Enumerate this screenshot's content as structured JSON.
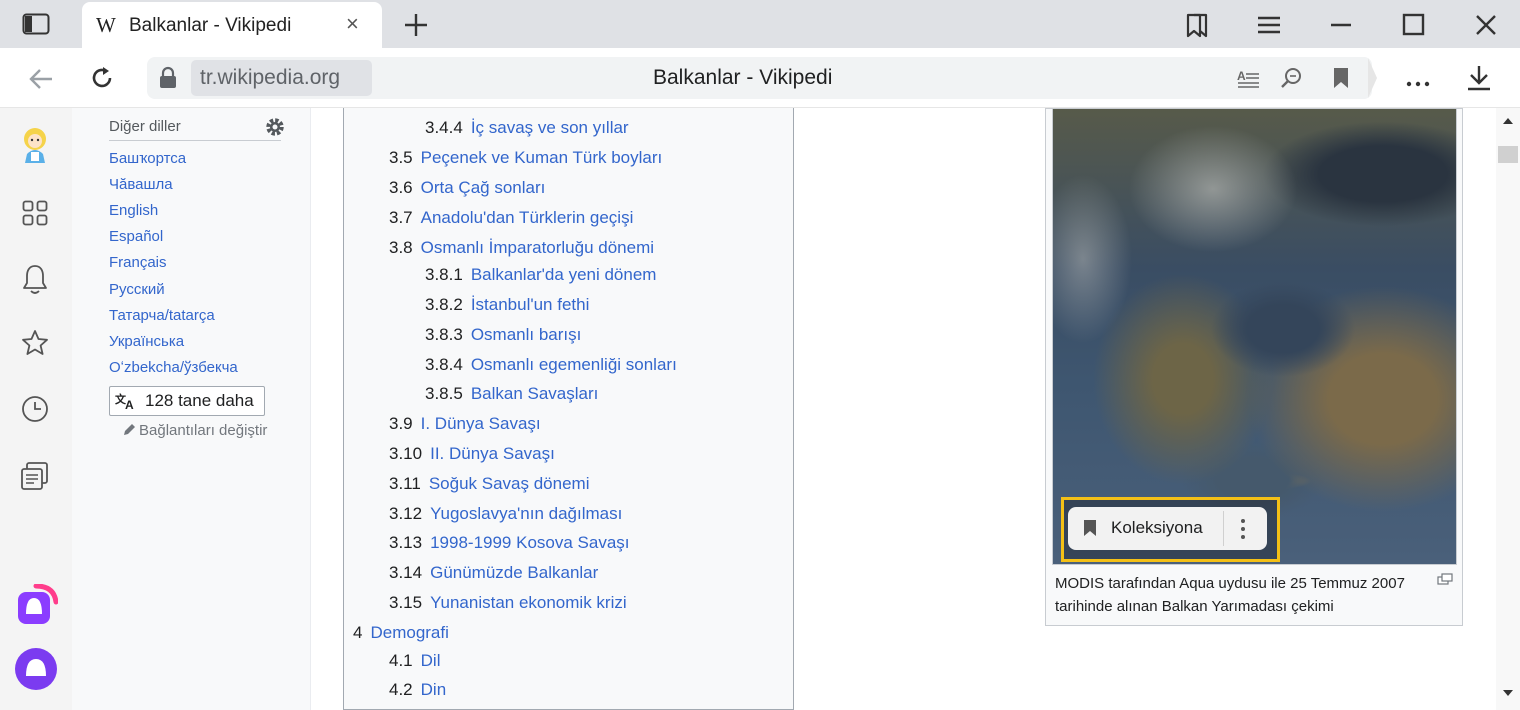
{
  "browser": {
    "tab_title": "Balkanlar - Vikipedi",
    "tab_logo": "W",
    "url_domain": "tr.wikipedia.org",
    "page_title": "Balkanlar - Vikipedi",
    "icons": {
      "sidebar_toggle": "sidebar-icon",
      "tab_close": "×",
      "new_tab": "+",
      "menu": "≡",
      "minimize": "—",
      "maximize": "□",
      "close": "✕",
      "back": "←",
      "reload": "↻",
      "more": "…"
    }
  },
  "languages": {
    "header": "Diğer diller",
    "items": [
      "Башҡортса",
      "Чӑвашла",
      "English",
      "Español",
      "Français",
      "Русский",
      "Татарча/tatarça",
      "Українська",
      "Oʻzbekcha/ўзбекча"
    ],
    "more_button": "128 tane daha",
    "edit_links": "Bağlantıları değiştir"
  },
  "toc": [
    {
      "num": "3.4.4",
      "title": "İç savaş ve son yıllar",
      "level": 3
    },
    {
      "num": "3.5",
      "title": "Peçenek ve Kuman Türk boyları",
      "level": 2
    },
    {
      "num": "3.6",
      "title": "Orta Çağ sonları",
      "level": 2
    },
    {
      "num": "3.7",
      "title": "Anadolu'dan Türklerin geçişi",
      "level": 2
    },
    {
      "num": "3.8",
      "title": "Osmanlı İmparatorluğu dönemi",
      "level": 2
    },
    {
      "num": "3.8.1",
      "title": "Balkanlar'da yeni dönem",
      "level": 3
    },
    {
      "num": "3.8.2",
      "title": "İstanbul'un fethi",
      "level": 3
    },
    {
      "num": "3.8.3",
      "title": "Osmanlı barışı",
      "level": 3
    },
    {
      "num": "3.8.4",
      "title": "Osmanlı egemenliği sonları",
      "level": 3
    },
    {
      "num": "3.8.5",
      "title": "Balkan Savaşları",
      "level": 3
    },
    {
      "num": "3.9",
      "title": "I. Dünya Savaşı",
      "level": 2
    },
    {
      "num": "3.10",
      "title": "II. Dünya Savaşı",
      "level": 2
    },
    {
      "num": "3.11",
      "title": "Soğuk Savaş dönemi",
      "level": 2
    },
    {
      "num": "3.12",
      "title": "Yugoslavya'nın dağılması",
      "level": 2
    },
    {
      "num": "3.13",
      "title": "1998-1999 Kosova Savaşı",
      "level": 2
    },
    {
      "num": "3.14",
      "title": "Günümüzde Balkanlar",
      "level": 2
    },
    {
      "num": "3.15",
      "title": "Yunanistan ekonomik krizi",
      "level": 2
    },
    {
      "num": "4",
      "title": "Demografi",
      "level": 1
    },
    {
      "num": "4.1",
      "title": "Dil",
      "level": 2
    },
    {
      "num": "4.2",
      "title": "Din",
      "level": 2
    }
  ],
  "image_caption": "MODIS tarafından Aqua uydusu ile 25 Temmuz 2007 tarihinde alınan Balkan Yarımadası çekimi",
  "collection_button": "Koleksiyona",
  "colors": {
    "link": "#3366cc",
    "highlight": "#f4c016",
    "alice_purple": "#7b3bf0"
  }
}
